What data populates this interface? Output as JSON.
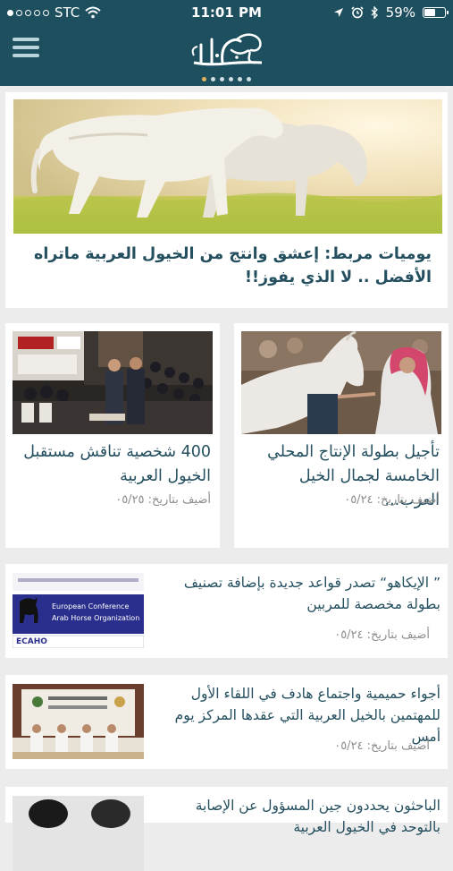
{
  "status_bar": {
    "carrier": "STC",
    "time": "11:01 PM",
    "battery": "59%",
    "battery_level": 0.59,
    "signal_bars": 1
  },
  "nav": {
    "menu_icon": "hamburger-menu-icon",
    "logo_icon": "alkhaial-logo"
  },
  "page_indicator": {
    "count": 6,
    "active": 0
  },
  "articles": {
    "featured": {
      "title": "يوميات مربط: إعشق وانتج من الخيول العربية ماتراه الأفضل .. لا الذي يفوز!!"
    },
    "grid": [
      {
        "title": "تأجيل بطولة الإنتاج المحلي الخامسة لجمال الخيل العرب...",
        "date": "أضيف بتاريخ: ٠٥/٢٤"
      },
      {
        "title": "400 شخصية تناقش مستقبل الخيول العربية",
        "date": "أضيف بتاريخ: ٠٥/٢٥"
      }
    ],
    "list": [
      {
        "title": "” الإيكاهو“ تصدر قواعد جديدة بإضافة تصنيف بطولة مخصصة للمربين",
        "date": "أضيف بتاريخ: ٠٥/٢٤",
        "thumb": {
          "line1": "European Conference",
          "line2": "Arab Horse Organization",
          "org": "ECAHO"
        }
      },
      {
        "title": "أجواء حميمية واجتماع هادف في اللقاء الأول للمهتمين بالخيل العربية التي عقدها المركز يوم أمس",
        "date": "أضيف بتاريخ: ٠٥/٢٤"
      },
      {
        "title": "الباحثون يحددون جين المسؤول عن الإصابة بالتوحد في الخيول العربية",
        "date": ""
      }
    ]
  },
  "colors": {
    "header": "#1d4f5e",
    "title": "#244f5f",
    "date": "#8c8c8c",
    "indicator_active": "#e3b35a",
    "background": "#ececec"
  }
}
